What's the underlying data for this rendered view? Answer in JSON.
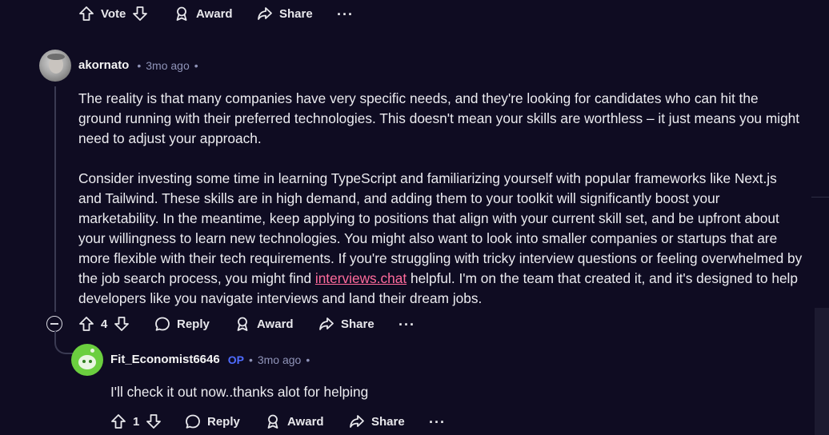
{
  "top_actions": {
    "vote": "Vote",
    "award": "Award",
    "share": "Share",
    "more": "···"
  },
  "comment1": {
    "username": "akornato",
    "separator": "•",
    "time": "3mo ago",
    "para1": "The reality is that many companies have very specific needs, and they're looking for candidates who can hit the ground running with their preferred technologies. This doesn't mean your skills are worthless – it just means you might need to adjust your approach.",
    "para2_before": "Consider investing some time in learning TypeScript and familiarizing yourself with popular frameworks like Next.js and Tailwind. These skills are in high demand, and adding them to your toolkit will significantly boost your marketability. In the meantime, keep applying to positions that align with your current skill set, and be upfront about your willingness to learn new technologies. You might also want to look into smaller companies or startups that are more flexible with their tech requirements. If you're struggling with tricky interview questions or feeling overwhelmed by the job search process, you might find ",
    "para2_link": "interviews.chat",
    "para2_after": " helpful. I'm on the team that created it, and it's designed to help developers like you navigate interviews and land their dream jobs.",
    "votes": "4",
    "reply": "Reply",
    "award": "Award",
    "share": "Share",
    "more": "···"
  },
  "comment2": {
    "username": "Fit_Economist6646",
    "op": "OP",
    "separator": "•",
    "time": "3mo ago",
    "body": "I'll check it out now..thanks alot for helping",
    "votes": "1",
    "reply": "Reply",
    "award": "Award",
    "share": "Share",
    "more": "···"
  },
  "colors": {
    "background": "#0f0c22",
    "link": "#ff6b9c",
    "op": "#4f6cff",
    "meta": "#8f93b8"
  }
}
